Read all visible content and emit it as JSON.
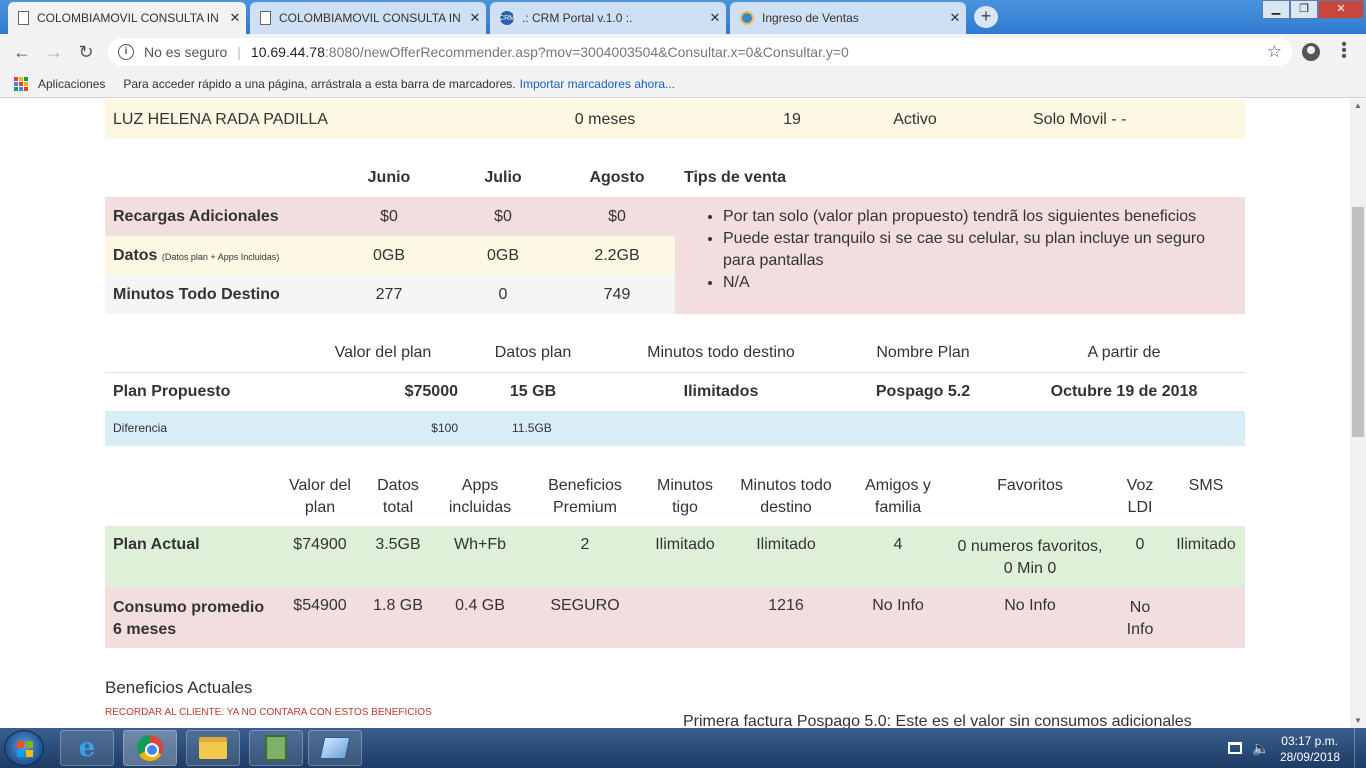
{
  "browser": {
    "tabs": [
      {
        "title": "COLOMBIAMOVIL CONSULTA IN",
        "favicon": "document-icon"
      },
      {
        "title": "COLOMBIAMOVIL CONSULTA IN",
        "favicon": "document-icon"
      },
      {
        "title": ".: CRM Portal v.1.0 :.",
        "favicon": "crm-icon"
      },
      {
        "title": "Ingreso de Ventas",
        "favicon": "globe-icon"
      }
    ],
    "insecure_label": "No es seguro",
    "url_host": "10.69.44.78",
    "url_rest": ":8080/newOfferRecommender.asp?mov=3004003504&Consultar.x=0&Consultar.y=0",
    "bookmarks": {
      "apps_label": "Aplicaciones",
      "hint": "Para acceder rápido a una página, arrástrala a esta barra de marcadores.",
      "import_link": "Importar marcadores ahora..."
    }
  },
  "customer": {
    "name": "LUZ HELENA RADA PADILLA",
    "tenure": "0 meses",
    "number": "19",
    "status": "Activo",
    "segment": "Solo Movil - -"
  },
  "usage": {
    "months": [
      "Junio",
      "Julio",
      "Agosto"
    ],
    "tips_title": "Tips de venta",
    "rows": [
      {
        "label": "Recargas Adicionales",
        "note": "",
        "values": [
          "$0",
          "$0",
          "$0"
        ]
      },
      {
        "label": "Datos",
        "note": "(Datos plan + Apps Incluidas)",
        "values": [
          "0GB",
          "0GB",
          "2.2GB"
        ]
      },
      {
        "label": "Minutos Todo Destino",
        "note": "",
        "values": [
          "277",
          "0",
          "749"
        ]
      }
    ],
    "tips": [
      "Por tan solo (valor plan propuesto) tendrã los siguientes beneficios",
      "Puede estar tranquilo si se cae su celular, su plan incluye un seguro para pantallas",
      "N/A"
    ]
  },
  "proposed": {
    "headers": [
      "Valor del plan",
      "Datos plan",
      "Minutos todo destino",
      "Nombre Plan",
      "A partir de"
    ],
    "row_label": "Plan Propuesto",
    "values": [
      "$75000",
      "15 GB",
      "Ilimitados",
      "Pospago 5.2",
      "Octubre 19 de 2018"
    ],
    "diff_label": "Diferencia",
    "diff_values": [
      "$100",
      "11.5GB"
    ]
  },
  "current": {
    "headers": [
      [
        "Valor del",
        "plan"
      ],
      [
        "Datos",
        "total"
      ],
      [
        "Apps",
        "incluidas"
      ],
      [
        "Beneficios",
        "Premium"
      ],
      [
        "Minutos",
        "tigo"
      ],
      [
        "Minutos todo",
        "destino"
      ],
      [
        "Amigos y",
        "familia"
      ],
      [
        "Favoritos",
        ""
      ],
      [
        "Voz",
        "LDI"
      ],
      [
        "SMS",
        ""
      ]
    ],
    "plan_label": "Plan Actual",
    "plan_values": [
      "$74900",
      "3.5GB",
      "Wh+Fb",
      "2",
      "Ilimitado",
      "Ilimitado",
      "4",
      "0 numeros favoritos, 0 Min 0",
      "0",
      "Ilimitado"
    ],
    "avg_label_1": "Consumo promedio",
    "avg_label_2": "6 meses",
    "avg_values": [
      "$54900",
      "1.8 GB",
      "0.4 GB",
      "SEGURO",
      "",
      "1216",
      "No Info",
      "No Info",
      "No Info",
      ""
    ]
  },
  "benefits": {
    "title": "Beneficios Actuales",
    "warning": "RECORDAR AL CLIENTE: YA NO CONTARA CON ESTOS BENEFICIOS",
    "invoice_note": "Primera factura Pospago 5.0: Este es el valor sin consumos adicionales"
  },
  "taskbar": {
    "time": "03:17 p.m.",
    "date": "28/09/2018"
  },
  "colors": {
    "titlebar": "#2f7ad0",
    "warning_red": "#c0392b",
    "row_yellow": "#fcf8e3",
    "row_red": "#f2dede",
    "row_blue": "#d9edf7",
    "row_green": "#dff0d8"
  }
}
